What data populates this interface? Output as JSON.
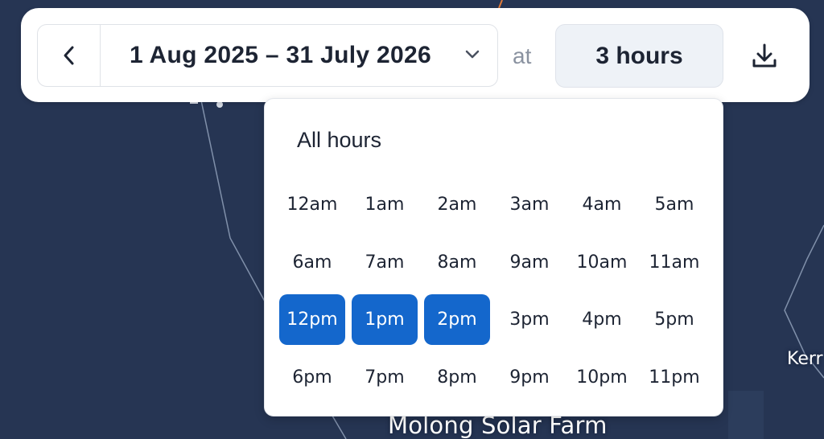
{
  "toolbar": {
    "date_range": "1 Aug 2025 – 31 July 2026",
    "at_label": "at",
    "hours_label": "3 hours"
  },
  "dropdown": {
    "all_hours_label": "All hours",
    "hours": [
      {
        "label": "12am",
        "selected": false
      },
      {
        "label": "1am",
        "selected": false
      },
      {
        "label": "2am",
        "selected": false
      },
      {
        "label": "3am",
        "selected": false
      },
      {
        "label": "4am",
        "selected": false
      },
      {
        "label": "5am",
        "selected": false
      },
      {
        "label": "6am",
        "selected": false
      },
      {
        "label": "7am",
        "selected": false
      },
      {
        "label": "8am",
        "selected": false
      },
      {
        "label": "9am",
        "selected": false
      },
      {
        "label": "10am",
        "selected": false
      },
      {
        "label": "11am",
        "selected": false
      },
      {
        "label": "12pm",
        "selected": true
      },
      {
        "label": "1pm",
        "selected": true
      },
      {
        "label": "2pm",
        "selected": true
      },
      {
        "label": "3pm",
        "selected": false
      },
      {
        "label": "4pm",
        "selected": false
      },
      {
        "label": "5pm",
        "selected": false
      },
      {
        "label": "6pm",
        "selected": false
      },
      {
        "label": "7pm",
        "selected": false
      },
      {
        "label": "8pm",
        "selected": false
      },
      {
        "label": "9pm",
        "selected": false
      },
      {
        "label": "10pm",
        "selected": false
      },
      {
        "label": "11pm",
        "selected": false
      }
    ]
  },
  "map": {
    "labels": {
      "molong": "Molong Solar Farm",
      "kerr": "Kerr"
    }
  },
  "icons": {
    "prev": "chevron-left-icon",
    "dropdown": "chevron-down-icon",
    "download": "download-icon"
  },
  "colors": {
    "map_background": "#263553",
    "selected": "#1467cc",
    "text": "#1d2433",
    "muted": "#8a92a0"
  }
}
